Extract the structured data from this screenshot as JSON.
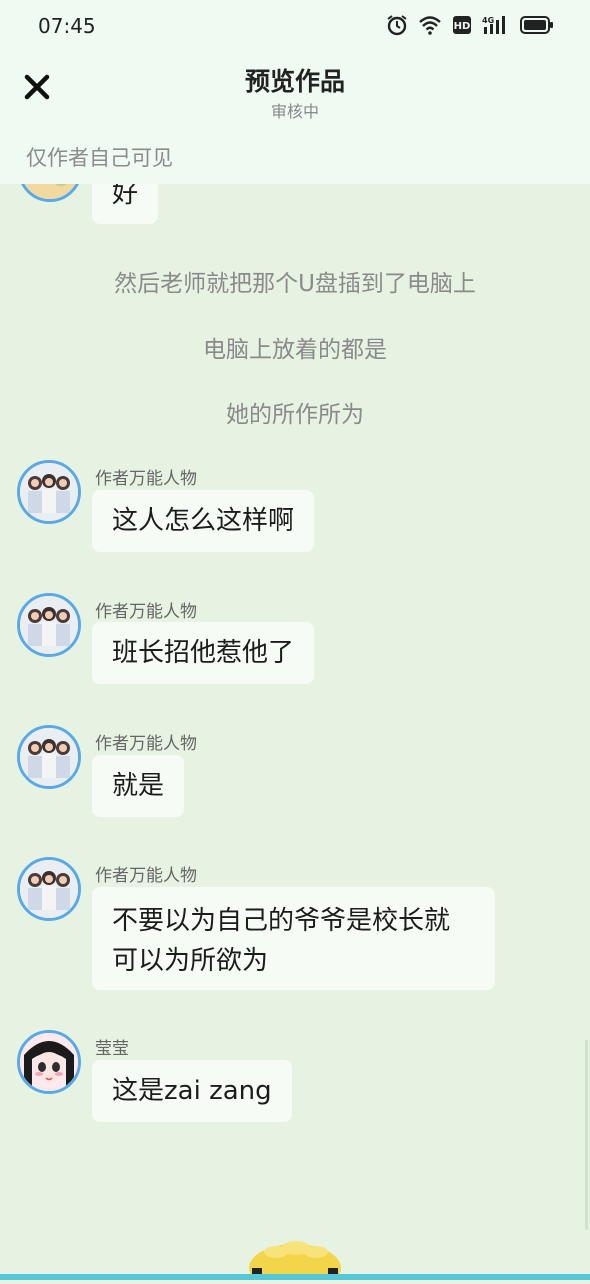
{
  "status": {
    "time": "07:45"
  },
  "header": {
    "title": "预览作品",
    "subtitle": "审核中",
    "visibility": "仅作者自己可见"
  },
  "messages": [
    {
      "type": "bubble",
      "text": "好"
    },
    {
      "type": "narration",
      "text": "然后老师就把那个U盘插到了电脑上"
    },
    {
      "type": "narration",
      "text": "电脑上放着的都是"
    },
    {
      "type": "narration",
      "text": "她的所作所为"
    },
    {
      "type": "bubble",
      "name": "作者万能人物",
      "text": "这人怎么这样啊"
    },
    {
      "type": "bubble",
      "name": "作者万能人物",
      "text": "班长招他惹他了"
    },
    {
      "type": "bubble",
      "name": "作者万能人物",
      "text": "就是"
    },
    {
      "type": "bubble",
      "name": "作者万能人物",
      "lines": [
        "不要以为自己的爷爷是校长就",
        "可以为所欲为"
      ]
    },
    {
      "type": "bubble",
      "name": "莹莹",
      "text": "这是zai  zang"
    }
  ],
  "colors": {
    "accent": "#5aa9e6",
    "background": "#e6f3e2",
    "header": "#effaf2"
  }
}
